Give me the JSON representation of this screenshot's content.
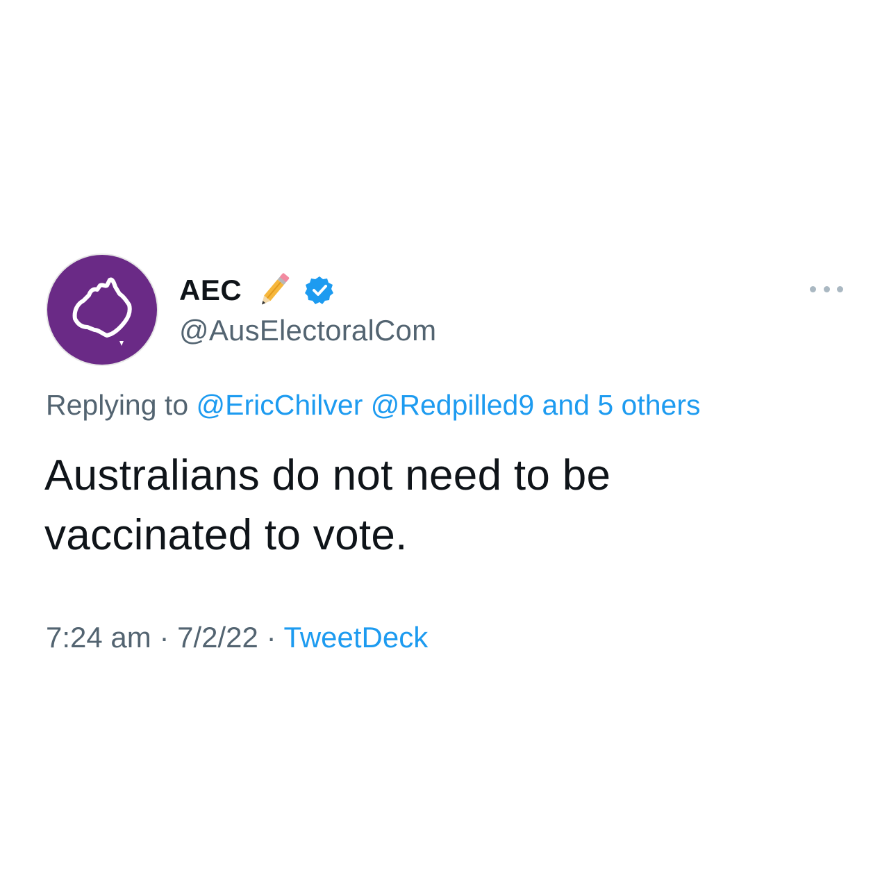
{
  "tweet": {
    "display_name": "AEC",
    "handle": "@AusElectoralCom",
    "avatar_icon": "australia-map-icon",
    "badge_icon": "verified-badge-icon",
    "emoji_icon": "pencil-emoji-icon",
    "replying_prefix": "Replying to",
    "reply_mention_1": "@EricChilver",
    "reply_mention_2": "@Redpilled9",
    "reply_others": "and 5 others",
    "body_line_1": "Australians do not need to be",
    "body_line_2": "vaccinated to vote.",
    "time": "7:24 am",
    "separator": "·",
    "date": "7/2/22",
    "source": "TweetDeck"
  },
  "colors": {
    "avatar_bg": "#6a2a86",
    "link": "#1d9bf0",
    "muted": "#536471",
    "text": "#0f1419",
    "verified": "#1d9bf0"
  }
}
